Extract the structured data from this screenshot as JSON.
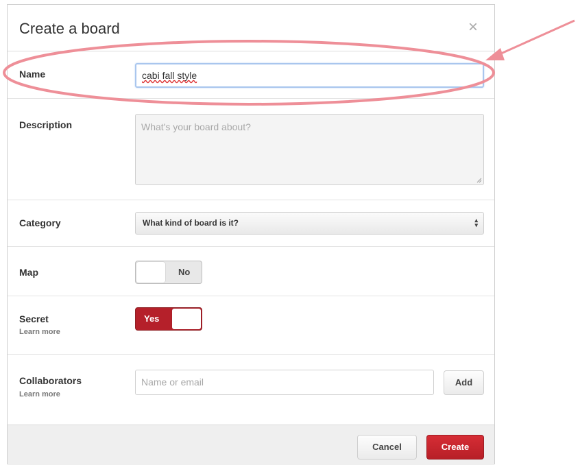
{
  "dialog": {
    "title": "Create a board",
    "close_icon": "close-icon"
  },
  "fields": {
    "name": {
      "label": "Name",
      "value": "cabi fall style"
    },
    "description": {
      "label": "Description",
      "placeholder": "What's your board about?"
    },
    "category": {
      "label": "Category",
      "selected": "What kind of board is it?"
    },
    "map": {
      "label": "Map",
      "toggle_text": "No",
      "state": "off"
    },
    "secret": {
      "label": "Secret",
      "learn_more": "Learn more",
      "toggle_text": "Yes",
      "state": "on"
    },
    "collaborators": {
      "label": "Collaborators",
      "learn_more": "Learn more",
      "placeholder": "Name or email",
      "add_label": "Add"
    }
  },
  "footer": {
    "cancel_label": "Cancel",
    "create_label": "Create"
  },
  "colors": {
    "accent_red": "#b5202a",
    "annotation_pink": "#ee8f98",
    "focus_blue": "#a9c6ee"
  }
}
